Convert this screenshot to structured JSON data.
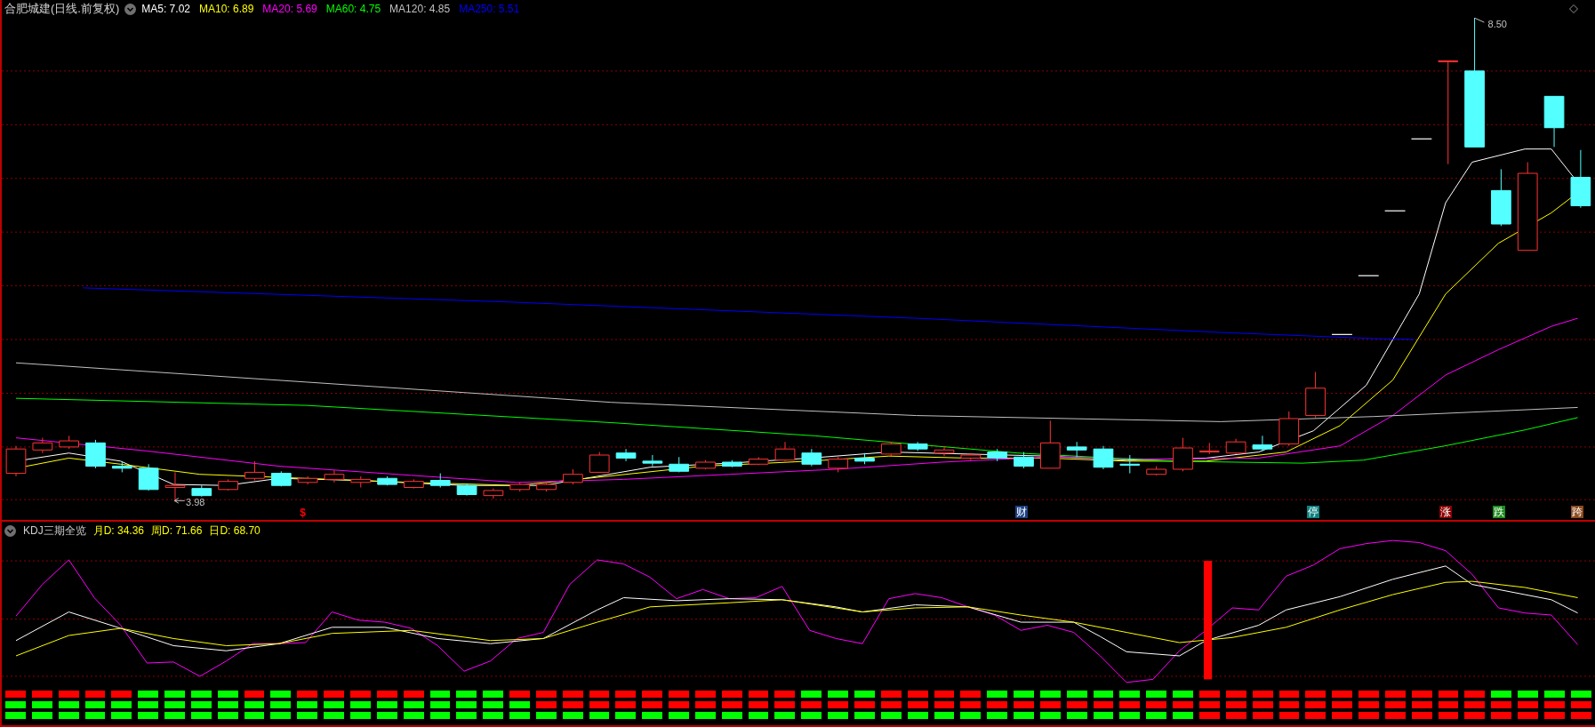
{
  "price_panel": {
    "title": "合肥城建(日线.前复权)",
    "moving_averages": [
      {
        "label": "MA5: 7.02",
        "color": "#ffffff"
      },
      {
        "label": "MA10: 6.89",
        "color": "#ffff00"
      },
      {
        "label": "MA20: 5.69",
        "color": "#ff00ff"
      },
      {
        "label": "MA60: 4.75",
        "color": "#00ff00"
      },
      {
        "label": "MA120: 4.85",
        "color": "#c0c0c0"
      },
      {
        "label": "MA250: 5.51",
        "color": "#0000ff"
      }
    ],
    "low_label": "3.98",
    "high_label": "8.50",
    "markers": [
      {
        "text": "$",
        "kind": "text",
        "color": "#ff0000"
      },
      {
        "text": "财",
        "kind": "badge",
        "color": "#1c3f80"
      },
      {
        "text": "停",
        "kind": "badge",
        "color": "#0e8080"
      },
      {
        "text": "涨",
        "kind": "badge",
        "color": "#8b0000"
      },
      {
        "text": "跌",
        "kind": "badge",
        "color": "#1e8b1e"
      },
      {
        "text": "跨",
        "kind": "badge",
        "color": "#8b4a1e"
      }
    ]
  },
  "kdj_panel": {
    "title": "KDJ三期全览",
    "values": [
      "月D: 34.36",
      "周D: 71.66",
      "日D: 68.70"
    ]
  },
  "signal_rows": [
    {
      "cells": [
        {
          "color": "#ff0000"
        },
        {
          "color": "#ff0000"
        },
        {
          "color": "#ff0000"
        },
        {
          "color": "#ff0000"
        },
        {
          "color": "#ff0000"
        },
        {
          "color": "#00ff00"
        },
        {
          "color": "#00ff00"
        },
        {
          "color": "#00ff00"
        },
        {
          "color": "#00ff00"
        },
        {
          "color": "#ff0000"
        },
        {
          "color": "#00ff00"
        },
        {
          "color": "#ff0000"
        },
        {
          "color": "#ff0000"
        },
        {
          "color": "#ff0000"
        },
        {
          "color": "#ff0000"
        },
        {
          "color": "#ff0000"
        },
        {
          "color": "#00ff00"
        },
        {
          "color": "#00ff00"
        },
        {
          "color": "#00ff00"
        },
        {
          "color": "#ff0000"
        },
        {
          "color": "#ff0000"
        },
        {
          "color": "#ff0000"
        },
        {
          "color": "#ff0000"
        },
        {
          "color": "#ff0000"
        },
        {
          "color": "#ff0000"
        },
        {
          "color": "#ff0000"
        },
        {
          "color": "#ff0000"
        },
        {
          "color": "#ff0000"
        },
        {
          "color": "#ff0000"
        },
        {
          "color": "#ff0000"
        },
        {
          "color": "#00ff00"
        },
        {
          "color": "#00ff00"
        },
        {
          "color": "#00ff00"
        },
        {
          "color": "#ff0000"
        },
        {
          "color": "#ff0000"
        },
        {
          "color": "#ff0000"
        },
        {
          "color": "#ff0000"
        },
        {
          "color": "#00ff00"
        },
        {
          "color": "#00ff00"
        },
        {
          "color": "#00ff00"
        },
        {
          "color": "#00ff00"
        },
        {
          "color": "#00ff00"
        },
        {
          "color": "#00ff00"
        },
        {
          "color": "#00ff00"
        },
        {
          "color": "#00ff00"
        },
        {
          "color": "#ff0000"
        },
        {
          "color": "#ff0000"
        },
        {
          "color": "#ff0000"
        },
        {
          "color": "#ff0000"
        },
        {
          "color": "#ff0000"
        },
        {
          "color": "#ff0000"
        },
        {
          "color": "#ff0000"
        },
        {
          "color": "#ff0000"
        },
        {
          "color": "#ff0000"
        },
        {
          "color": "#ff0000"
        },
        {
          "color": "#ff0000"
        },
        {
          "color": "#00ff00"
        },
        {
          "color": "#00ff00"
        },
        {
          "color": "#00ff00"
        },
        {
          "color": "#00ff00"
        }
      ]
    },
    {
      "cells": [
        {
          "color": "#00ff00"
        },
        {
          "color": "#00ff00"
        },
        {
          "color": "#00ff00"
        },
        {
          "color": "#00ff00"
        },
        {
          "color": "#00ff00"
        },
        {
          "color": "#00ff00"
        },
        {
          "color": "#00ff00"
        },
        {
          "color": "#00ff00"
        },
        {
          "color": "#00ff00"
        },
        {
          "color": "#00ff00"
        },
        {
          "color": "#00ff00"
        },
        {
          "color": "#00ff00"
        },
        {
          "color": "#00ff00"
        },
        {
          "color": "#00ff00"
        },
        {
          "color": "#00ff00"
        },
        {
          "color": "#00ff00"
        },
        {
          "color": "#00ff00"
        },
        {
          "color": "#00ff00"
        },
        {
          "color": "#00ff00"
        },
        {
          "color": "#00ff00"
        },
        {
          "color": "#ff0000"
        },
        {
          "color": "#ff0000"
        },
        {
          "color": "#ff0000"
        },
        {
          "color": "#ff0000"
        },
        {
          "color": "#ff0000"
        },
        {
          "color": "#ff0000"
        },
        {
          "color": "#ff0000"
        },
        {
          "color": "#ff0000"
        },
        {
          "color": "#ff0000"
        },
        {
          "color": "#ff0000"
        },
        {
          "color": "#ff0000"
        },
        {
          "color": "#ff0000"
        },
        {
          "color": "#ff0000"
        },
        {
          "color": "#ff0000"
        },
        {
          "color": "#ff0000"
        },
        {
          "color": "#ff0000"
        },
        {
          "color": "#ff0000"
        },
        {
          "color": "#ff0000"
        },
        {
          "color": "#ff0000"
        },
        {
          "color": "#ff0000"
        },
        {
          "color": "#ff0000"
        },
        {
          "color": "#ff0000"
        },
        {
          "color": "#ff0000"
        },
        {
          "color": "#ff0000"
        },
        {
          "color": "#ff0000"
        },
        {
          "color": "#ff0000"
        },
        {
          "color": "#ff0000"
        },
        {
          "color": "#ff0000"
        },
        {
          "color": "#ff0000"
        },
        {
          "color": "#ff0000"
        },
        {
          "color": "#ff0000"
        },
        {
          "color": "#ff0000"
        },
        {
          "color": "#ff0000"
        },
        {
          "color": "#ff0000"
        },
        {
          "color": "#ff0000"
        },
        {
          "color": "#ff0000"
        },
        {
          "color": "#ff0000"
        },
        {
          "color": "#ff0000"
        },
        {
          "color": "#ff0000"
        },
        {
          "color": "#ff0000"
        }
      ]
    },
    {
      "cells": [
        {
          "color": "#00ff00"
        },
        {
          "color": "#00ff00"
        },
        {
          "color": "#00ff00"
        },
        {
          "color": "#00ff00"
        },
        {
          "color": "#00ff00"
        },
        {
          "color": "#00ff00"
        },
        {
          "color": "#00ff00"
        },
        {
          "color": "#00ff00"
        },
        {
          "color": "#00ff00"
        },
        {
          "color": "#00ff00"
        },
        {
          "color": "#00ff00"
        },
        {
          "color": "#00ff00"
        },
        {
          "color": "#00ff00"
        },
        {
          "color": "#00ff00"
        },
        {
          "color": "#00ff00"
        },
        {
          "color": "#00ff00"
        },
        {
          "color": "#00ff00"
        },
        {
          "color": "#00ff00"
        },
        {
          "color": "#00ff00"
        },
        {
          "color": "#00ff00"
        },
        {
          "color": "#00ff00"
        },
        {
          "color": "#00ff00"
        },
        {
          "color": "#00ff00"
        },
        {
          "color": "#00ff00"
        },
        {
          "color": "#00ff00"
        },
        {
          "color": "#00ff00"
        },
        {
          "color": "#00ff00"
        },
        {
          "color": "#00ff00"
        },
        {
          "color": "#00ff00"
        },
        {
          "color": "#00ff00"
        },
        {
          "color": "#00ff00"
        },
        {
          "color": "#00ff00"
        },
        {
          "color": "#00ff00"
        },
        {
          "color": "#00ff00"
        },
        {
          "color": "#00ff00"
        },
        {
          "color": "#00ff00"
        },
        {
          "color": "#00ff00"
        },
        {
          "color": "#00ff00"
        },
        {
          "color": "#00ff00"
        },
        {
          "color": "#00ff00"
        },
        {
          "color": "#00ff00"
        },
        {
          "color": "#00ff00"
        },
        {
          "color": "#00ff00"
        },
        {
          "color": "#00ff00"
        },
        {
          "color": "#00ff00"
        },
        {
          "color": "#ff0000"
        },
        {
          "color": "#ff0000"
        },
        {
          "color": "#ff0000"
        },
        {
          "color": "#ff0000"
        },
        {
          "color": "#ff0000"
        },
        {
          "color": "#ff0000"
        },
        {
          "color": "#ff0000"
        },
        {
          "color": "#ff0000"
        },
        {
          "color": "#ff0000"
        },
        {
          "color": "#ff0000"
        },
        {
          "color": "#ff0000"
        },
        {
          "color": "#ff0000"
        },
        {
          "color": "#ff0000"
        },
        {
          "color": "#ff0000"
        },
        {
          "color": "#ff0000"
        }
      ]
    }
  ]
}
